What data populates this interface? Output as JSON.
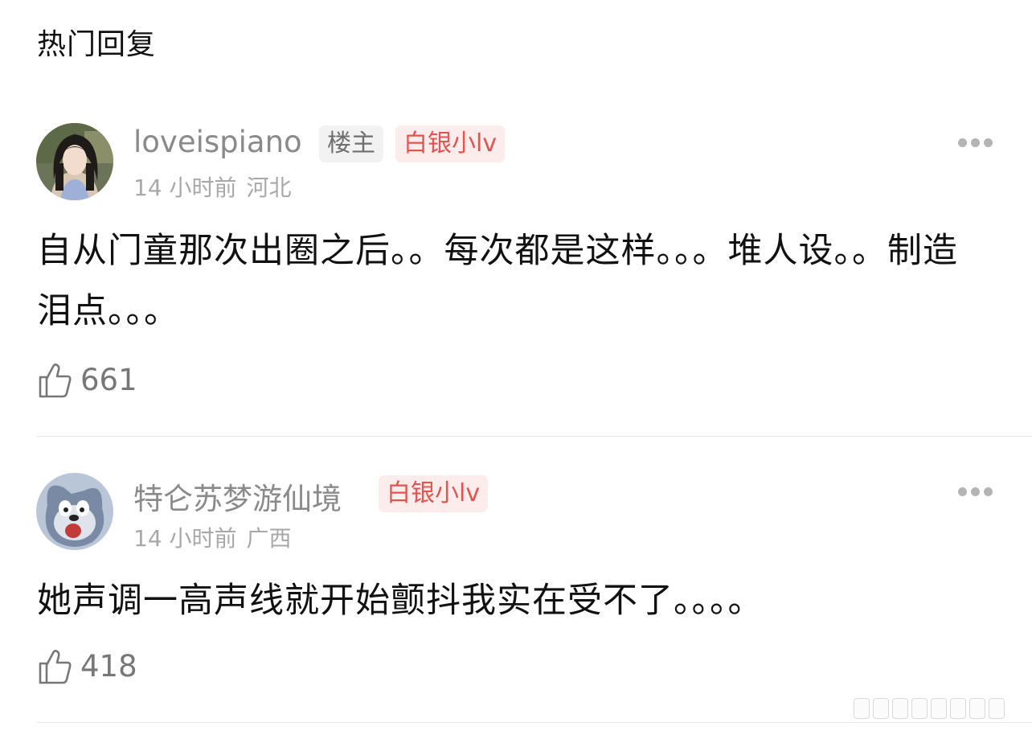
{
  "section": {
    "title": "热门回复"
  },
  "comments": [
    {
      "username": "loveispiano",
      "badges": [
        "楼主",
        "白银小lv"
      ],
      "time": "14 小时前",
      "location": "河北",
      "text": "自从门童那次出圈之后。。每次都是这样。。。堆人设。。制造泪点。。。",
      "likes": "661",
      "avatar_icon": "girl-portrait"
    },
    {
      "username": "特仑苏梦游仙境",
      "badges": [
        "白银小lv"
      ],
      "time": "14 小时前",
      "location": "广西",
      "text": "她声调一高声线就开始颤抖我实在受不了。。。。",
      "likes": "418",
      "avatar_icon": "cartoon-cat"
    }
  ],
  "icons": {
    "more": "more-icon",
    "like": "thumbs-up-icon"
  },
  "colors": {
    "badge_red_text": "#e2544f",
    "badge_red_bg": "#fdecec",
    "badge_gray_bg": "#f2f2f2"
  }
}
